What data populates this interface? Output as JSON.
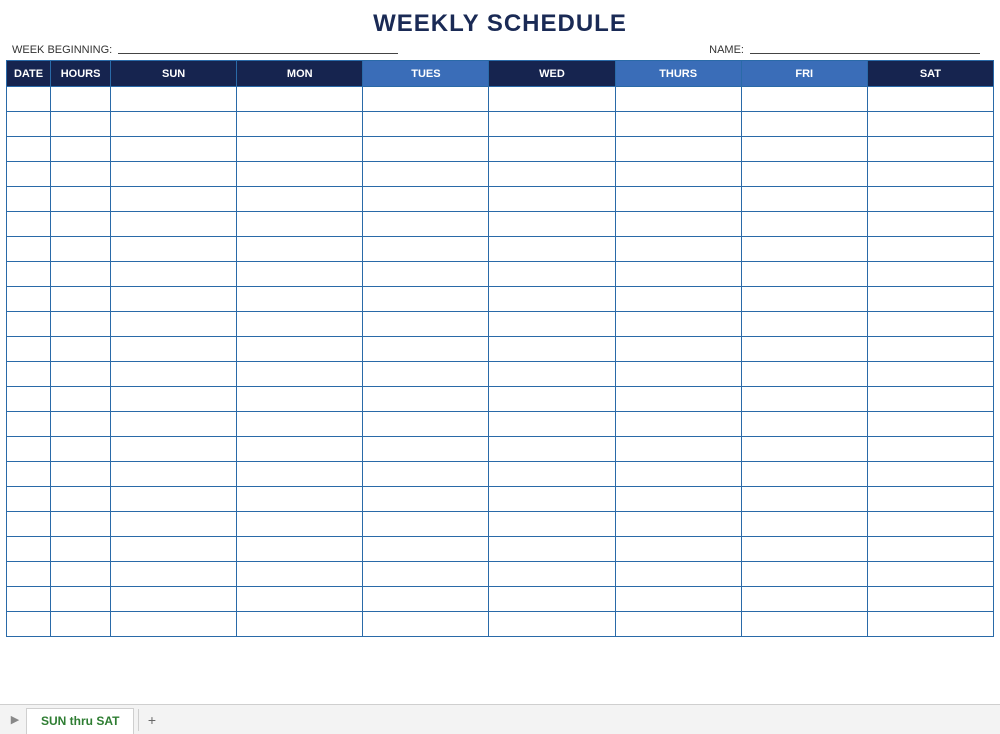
{
  "title": "WEEKLY SCHEDULE",
  "meta": {
    "week_beginning_label": "WEEK BEGINNING:",
    "week_beginning_value": "",
    "name_label": "NAME:",
    "name_value": ""
  },
  "columns": {
    "date": {
      "label": "DATE",
      "shade": "dark"
    },
    "hours": {
      "label": "HOURS",
      "shade": "dark"
    },
    "sun": {
      "label": "SUN",
      "shade": "dark"
    },
    "mon": {
      "label": "MON",
      "shade": "dark"
    },
    "tues": {
      "label": "TUES",
      "shade": "light"
    },
    "wed": {
      "label": "WED",
      "shade": "dark"
    },
    "thurs": {
      "label": "THURS",
      "shade": "light"
    },
    "fri": {
      "label": "FRI",
      "shade": "light"
    },
    "sat": {
      "label": "SAT",
      "shade": "dark"
    }
  },
  "row_count": 22,
  "sheet_tabs": {
    "active": "SUN thru SAT"
  }
}
